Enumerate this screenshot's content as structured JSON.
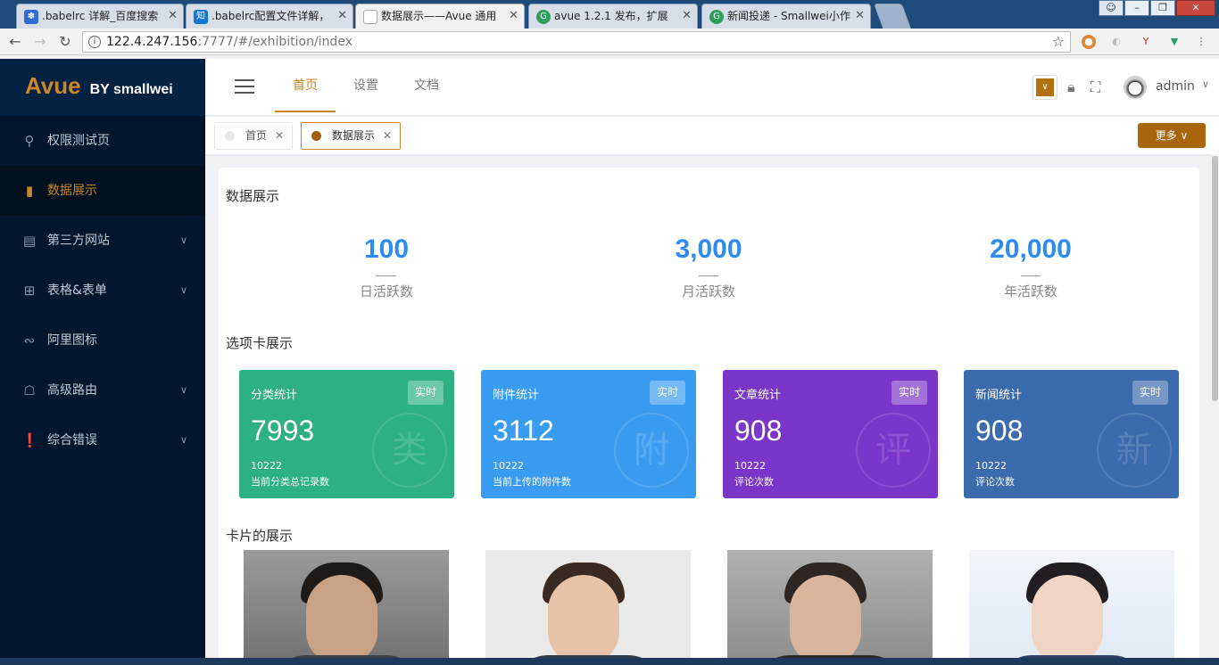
{
  "browser": {
    "tabs": [
      {
        "label": ".babelrc 详解_百度搜索",
        "icon": "baidu-icon",
        "color": "#2f6bd6",
        "glyph": "✽"
      },
      {
        "label": ".babelrc配置文件详解，",
        "icon": "zhihu-icon",
        "color": "#0f78d7",
        "glyph": "知"
      },
      {
        "label": "数据展示——Avue 通用",
        "icon": "page-icon",
        "color": "#888888",
        "glyph": "▢"
      },
      {
        "label": "avue 1.2.1 发布，扩展",
        "icon": "oschina-icon",
        "color": "#2e9e5b",
        "glyph": "G"
      },
      {
        "label": "新闻投递 - Smallwei小作",
        "icon": "oschina-icon",
        "color": "#2e9e5b",
        "glyph": "G"
      }
    ],
    "url_host": "122.4.247.156",
    "url_rest": ":7777/#/exhibition/index"
  },
  "sidebar": {
    "brand": "Avue",
    "by": "BY smallwei",
    "items": [
      {
        "label": "权限测试页",
        "icon": "search-icon",
        "glyph": "⚲",
        "has_children": false
      },
      {
        "label": "数据展示",
        "icon": "bar-chart-icon",
        "glyph": "▮",
        "has_children": false,
        "active": true
      },
      {
        "label": "第三方网站",
        "icon": "browser-icon",
        "glyph": "▤",
        "has_children": true
      },
      {
        "label": "表格&表单",
        "icon": "table-icon",
        "glyph": "⊞",
        "has_children": true
      },
      {
        "label": "阿里图标",
        "icon": "link-icon",
        "glyph": "∾",
        "has_children": false
      },
      {
        "label": "高级路由",
        "icon": "route-icon",
        "glyph": "☖",
        "has_children": true
      },
      {
        "label": "综合错误",
        "icon": "error-icon",
        "glyph": "❗",
        "has_children": true
      }
    ],
    "chevron": "∨"
  },
  "header": {
    "nav": [
      "首页",
      "设置",
      "文档"
    ],
    "user": "admin"
  },
  "tags": {
    "items": [
      {
        "label": "首页",
        "active": false
      },
      {
        "label": "数据展示",
        "active": true
      }
    ],
    "close": "✕",
    "more": "更多 ∨"
  },
  "main": {
    "section1": "数据展示",
    "stats": [
      {
        "value": "100",
        "label": "日活跃数"
      },
      {
        "value": "3,000",
        "label": "月活跃数"
      },
      {
        "value": "20,000",
        "label": "年活跃数"
      }
    ],
    "section2": "选项卡展示",
    "cards": [
      {
        "title": "分类统计",
        "badge": "实时",
        "value": "7993",
        "sub": "10222",
        "desc": "当前分类总记录数",
        "mark": "类",
        "color": "#2db083"
      },
      {
        "title": "附件统计",
        "badge": "实时",
        "value": "3112",
        "sub": "10222",
        "desc": "当前上传的附件数",
        "mark": "附",
        "color": "#3a9cf0"
      },
      {
        "title": "文章统计",
        "badge": "实时",
        "value": "908",
        "sub": "10222",
        "desc": "评论次数",
        "mark": "评",
        "color": "#7a35c9"
      },
      {
        "title": "新闻统计",
        "badge": "实时",
        "value": "908",
        "sub": "10222",
        "desc": "评论次数",
        "mark": "新",
        "color": "#3b6aad"
      }
    ],
    "section3": "卡片的展示"
  }
}
